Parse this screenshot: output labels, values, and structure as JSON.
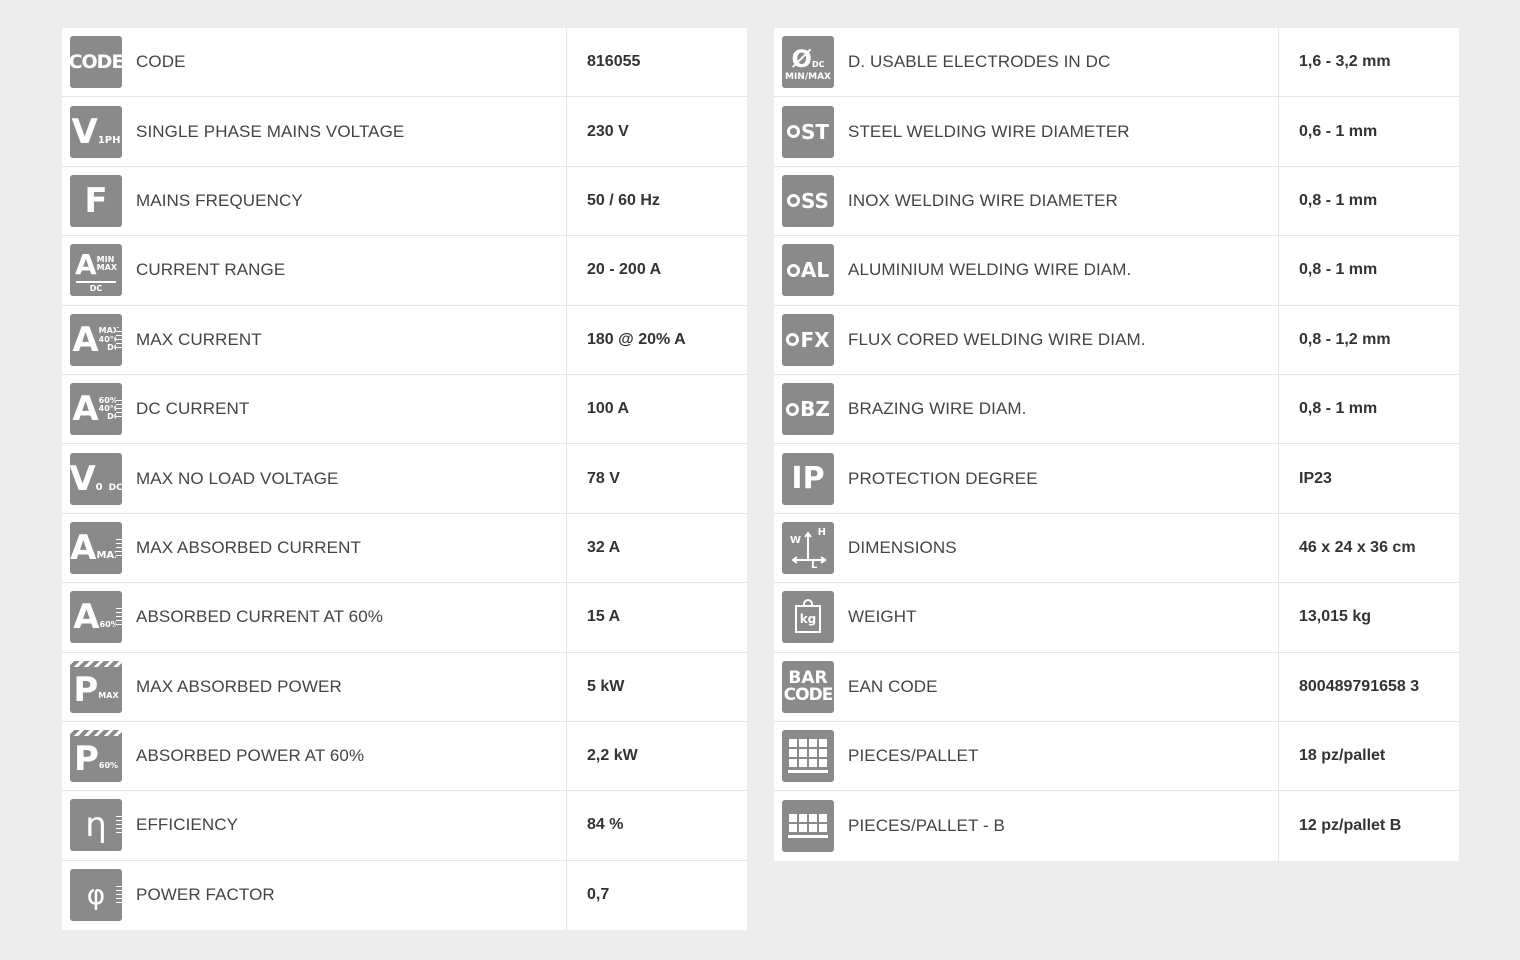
{
  "left_specs": [
    {
      "label": "CODE",
      "value": "816055",
      "icon": "code-icon"
    },
    {
      "label": "SINGLE PHASE MAINS VOLTAGE",
      "value": "230 V",
      "icon": "voltage-1ph-icon"
    },
    {
      "label": "MAINS FREQUENCY",
      "value": "50 / 60 Hz",
      "icon": "frequency-icon"
    },
    {
      "label": "CURRENT RANGE",
      "value": "20 - 200 A",
      "icon": "current-range-icon"
    },
    {
      "label": "MAX CURRENT",
      "value": "180 @ 20% A",
      "icon": "max-current-icon"
    },
    {
      "label": "DC CURRENT",
      "value": "100 A",
      "icon": "dc-current-icon"
    },
    {
      "label": "MAX NO LOAD VOLTAGE",
      "value": "78 V",
      "icon": "no-load-voltage-icon"
    },
    {
      "label": "MAX ABSORBED CURRENT",
      "value": "32 A",
      "icon": "max-absorbed-current-icon"
    },
    {
      "label": "ABSORBED CURRENT AT 60%",
      "value": "15 A",
      "icon": "absorbed-current-60-icon"
    },
    {
      "label": "MAX ABSORBED POWER",
      "value": "5 kW",
      "icon": "max-absorbed-power-icon"
    },
    {
      "label": "ABSORBED POWER AT 60%",
      "value": "2,2 kW",
      "icon": "absorbed-power-60-icon"
    },
    {
      "label": "EFFICIENCY",
      "value": "84 %",
      "icon": "efficiency-icon"
    },
    {
      "label": "POWER FACTOR",
      "value": "0,7",
      "icon": "power-factor-icon"
    }
  ],
  "right_specs": [
    {
      "label": "D. USABLE ELECTRODES IN DC",
      "value": "1,6 - 3,2 mm",
      "icon": "electrode-diameter-icon"
    },
    {
      "label": "STEEL WELDING WIRE DIAMETER",
      "value": "0,6 - 1 mm",
      "icon": "steel-wire-icon"
    },
    {
      "label": "INOX WELDING WIRE DIAMETER",
      "value": "0,8 - 1 mm",
      "icon": "inox-wire-icon"
    },
    {
      "label": "ALUMINIUM WELDING WIRE DIAM.",
      "value": "0,8 - 1 mm",
      "icon": "aluminium-wire-icon"
    },
    {
      "label": "FLUX CORED WELDING WIRE DIAM.",
      "value": "0,8 - 1,2 mm",
      "icon": "flux-wire-icon"
    },
    {
      "label": "BRAZING WIRE DIAM.",
      "value": "0,8 - 1 mm",
      "icon": "brazing-wire-icon"
    },
    {
      "label": "PROTECTION DEGREE",
      "value": "IP23",
      "icon": "protection-icon"
    },
    {
      "label": "DIMENSIONS",
      "value": "46 x 24 x 36 cm",
      "icon": "dimensions-icon"
    },
    {
      "label": "WEIGHT",
      "value": "13,015 kg",
      "icon": "weight-icon"
    },
    {
      "label": "EAN CODE",
      "value": "800489791658 3",
      "icon": "barcode-icon"
    },
    {
      "label": "PIECES/PALLET",
      "value": "18 pz/pallet",
      "icon": "pallet-icon"
    },
    {
      "label": "PIECES/PALLET - B",
      "value": "12 pz/pallet B",
      "icon": "pallet-b-icon"
    }
  ],
  "icon_text": {
    "code": "CODE",
    "v": "V",
    "one_ph": "1PH",
    "f": "F",
    "a": "A",
    "min": "MIN",
    "max": "MAX",
    "dc": "DC",
    "pct60": "60%",
    "temp40": "40°C",
    "zero": "0",
    "p": "P",
    "eta": "η",
    "phi": "φ",
    "diam": "Ø",
    "minmax": "MIN/MAX",
    "st": "ST",
    "ss": "SS",
    "al": "AL",
    "fx": "FX",
    "bz": "BZ",
    "ip": "IP",
    "w": "W",
    "h": "H",
    "l": "L",
    "kg": "kg",
    "bar": "BAR"
  },
  "colors": {
    "background": "#ededed",
    "table": "#ffffff",
    "icon": "#8a8a8a",
    "divider": "#e6e6e6"
  }
}
